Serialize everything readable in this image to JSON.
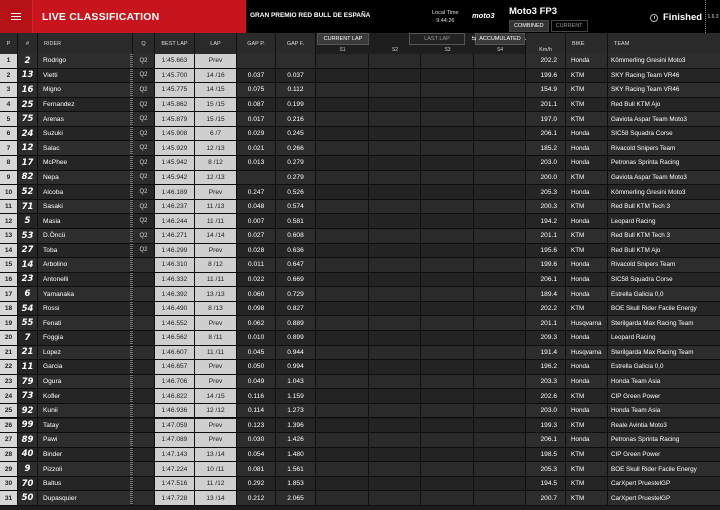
{
  "header": {
    "title": "LIVE CLASSIFICATION",
    "event": "GRAN PREMIO RED BULL DE ESPAÑA",
    "local_time_label": "Local Time",
    "local_time": "9:44:26",
    "logo": "moto3",
    "session": "Moto3 FP3",
    "tab_combined": "COMBINED",
    "tab_current": "CURRENT",
    "status": "Finished",
    "version": "1.6.3"
  },
  "columns": {
    "pos": "P",
    "num": "#",
    "rider": "RIDER",
    "q": "Q",
    "best_lap": "BEST LAP",
    "lap": "LAP",
    "gap_p": "GAP P.",
    "gap_f": "GAP F.",
    "current_lap": "CURRENT LAP",
    "last_lap": "LAST LAP",
    "accumulated": "ACCUMULATED",
    "s1": "S1",
    "s2": "S2",
    "s3": "S3",
    "s4": "S4",
    "speed": "Km/h",
    "bike": "BIKE",
    "team": "TEAM"
  },
  "rows": [
    {
      "pos": "1",
      "num": "2",
      "rider": "Rodrigo",
      "q": "Q2",
      "best": "1:45.663",
      "lap": "Prev",
      "gapp": "",
      "gapf": "",
      "speed": "202.2",
      "bike": "Honda",
      "team": "Kömmerling Gresini Moto3"
    },
    {
      "pos": "2",
      "num": "13",
      "rider": "Vietti",
      "q": "Q2",
      "best": "1:45.700",
      "lap": "14 /16",
      "gapp": "0.037",
      "gapf": "0.037",
      "speed": "199.6",
      "bike": "KTM",
      "team": "SKY Racing Team VR46"
    },
    {
      "pos": "3",
      "num": "16",
      "rider": "Migno",
      "q": "Q2",
      "best": "1:45.775",
      "lap": "14 /15",
      "gapp": "0.075",
      "gapf": "0.112",
      "speed": "154.9",
      "bike": "KTM",
      "team": "SKY Racing Team VR46"
    },
    {
      "pos": "4",
      "num": "25",
      "rider": "Fernandez",
      "q": "Q2",
      "best": "1:45.862",
      "lap": "15 /15",
      "gapp": "0.087",
      "gapf": "0.199",
      "speed": "201.1",
      "bike": "KTM",
      "team": "Red Bull KTM Ajo"
    },
    {
      "pos": "5",
      "num": "75",
      "rider": "Arenas",
      "q": "Q2",
      "best": "1:45.879",
      "lap": "15 /15",
      "gapp": "0.017",
      "gapf": "0.216",
      "speed": "197.0",
      "bike": "KTM",
      "team": "Gaviota Aspar Team Moto3"
    },
    {
      "pos": "6",
      "num": "24",
      "rider": "Suzuki",
      "q": "Q2",
      "best": "1:45.908",
      "lap": "6 /7",
      "gapp": "0.029",
      "gapf": "0.245",
      "speed": "206.1",
      "bike": "Honda",
      "team": "SIC58 Squadra Corse"
    },
    {
      "pos": "7",
      "num": "12",
      "rider": "Salac",
      "q": "Q2",
      "best": "1:45.929",
      "lap": "12 /13",
      "gapp": "0.021",
      "gapf": "0.266",
      "speed": "185.2",
      "bike": "Honda",
      "team": "Rivacold Snipers Team"
    },
    {
      "pos": "8",
      "num": "17",
      "rider": "McPhee",
      "q": "Q2",
      "best": "1:45.942",
      "lap": "8 /12",
      "gapp": "0.013",
      "gapf": "0.279",
      "speed": "203.0",
      "bike": "Honda",
      "team": "Petronas Sprinta Racing"
    },
    {
      "pos": "9",
      "num": "82",
      "rider": "Nepa",
      "q": "Q2",
      "best": "1:45.942",
      "lap": "12 /13",
      "gapp": "",
      "gapf": "0.279",
      "speed": "200.0",
      "bike": "KTM",
      "team": "Gaviota Aspar Team Moto3"
    },
    {
      "pos": "10",
      "num": "52",
      "rider": "Alcoba",
      "q": "Q2",
      "best": "1:46.189",
      "lap": "Prev",
      "gapp": "0.247",
      "gapf": "0.526",
      "speed": "205.3",
      "bike": "Honda",
      "team": "Kömmerling Gresini Moto3"
    },
    {
      "pos": "11",
      "num": "71",
      "rider": "Sasaki",
      "q": "Q2",
      "best": "1:46.237",
      "lap": "11 /13",
      "gapp": "0.048",
      "gapf": "0.574",
      "speed": "200.3",
      "bike": "KTM",
      "team": "Red Bull KTM Tech 3"
    },
    {
      "pos": "12",
      "num": "5",
      "rider": "Masia",
      "q": "Q2",
      "best": "1:46.244",
      "lap": "11 /11",
      "gapp": "0.007",
      "gapf": "0.581",
      "speed": "194.2",
      "bike": "Honda",
      "team": "Leopard Racing"
    },
    {
      "pos": "13",
      "num": "53",
      "rider": "D.Öncü",
      "q": "Q2",
      "best": "1:46.271",
      "lap": "14 /14",
      "gapp": "0.027",
      "gapf": "0.608",
      "speed": "201.1",
      "bike": "KTM",
      "team": "Red Bull KTM Tech 3"
    },
    {
      "pos": "14",
      "num": "27",
      "rider": "Toba",
      "q": "Q2",
      "best": "1:46.299",
      "lap": "Prev",
      "gapp": "0.028",
      "gapf": "0.636",
      "speed": "195.6",
      "bike": "KTM",
      "team": "Red Bull KTM Ajo"
    },
    {
      "pos": "15",
      "num": "14",
      "rider": "Arbolino",
      "q": "",
      "best": "1:46.310",
      "lap": "8 /12",
      "gapp": "0.011",
      "gapf": "0.647",
      "speed": "199.6",
      "bike": "Honda",
      "team": "Rivacold Snipers Team"
    },
    {
      "pos": "16",
      "num": "23",
      "rider": "Antonelli",
      "q": "",
      "best": "1:46.332",
      "lap": "11 /11",
      "gapp": "0.022",
      "gapf": "0.669",
      "speed": "206.1",
      "bike": "Honda",
      "team": "SIC58 Squadra Corse"
    },
    {
      "pos": "17",
      "num": "6",
      "rider": "Yamanaka",
      "q": "",
      "best": "1:46.392",
      "lap": "13 /13",
      "gapp": "0.060",
      "gapf": "0.729",
      "speed": "189.4",
      "bike": "Honda",
      "team": "Estrella Galicia 0,0"
    },
    {
      "pos": "18",
      "num": "54",
      "rider": "Rossi",
      "q": "",
      "best": "1:46.490",
      "lap": "8 /13",
      "gapp": "0.098",
      "gapf": "0.827",
      "speed": "202.2",
      "bike": "KTM",
      "team": "BOE Skull Rider Facile Energy"
    },
    {
      "pos": "19",
      "num": "55",
      "rider": "Fenati",
      "q": "",
      "best": "1:46.552",
      "lap": "Prev",
      "gapp": "0.062",
      "gapf": "0.889",
      "speed": "201.1",
      "bike": "Husqvarna",
      "team": "Sterilgarda Max Racing Team"
    },
    {
      "pos": "20",
      "num": "7",
      "rider": "Foggia",
      "q": "",
      "best": "1:46.562",
      "lap": "8 /11",
      "gapp": "0.010",
      "gapf": "0.899",
      "speed": "209.3",
      "bike": "Honda",
      "team": "Leopard Racing"
    },
    {
      "pos": "21",
      "num": "21",
      "rider": "Lopez",
      "q": "",
      "best": "1:46.607",
      "lap": "11 /11",
      "gapp": "0.045",
      "gapf": "0.944",
      "speed": "191.4",
      "bike": "Husqvarna",
      "team": "Sterilgarda Max Racing Team"
    },
    {
      "pos": "22",
      "num": "11",
      "rider": "Garcia",
      "q": "",
      "best": "1:46.657",
      "lap": "Prev",
      "gapp": "0.050",
      "gapf": "0.994",
      "speed": "196.2",
      "bike": "Honda",
      "team": "Estrella Galicia 0,0"
    },
    {
      "pos": "23",
      "num": "79",
      "rider": "Ogura",
      "q": "",
      "best": "1:46.706",
      "lap": "Prev",
      "gapp": "0.049",
      "gapf": "1.043",
      "speed": "203.3",
      "bike": "Honda",
      "team": "Honda Team Asia"
    },
    {
      "pos": "24",
      "num": "73",
      "rider": "Kofler",
      "q": "",
      "best": "1:46.822",
      "lap": "14 /15",
      "gapp": "0.116",
      "gapf": "1.159",
      "speed": "202.6",
      "bike": "KTM",
      "team": "CIP Green Power"
    },
    {
      "pos": "25",
      "num": "92",
      "rider": "Kunii",
      "q": "",
      "best": "1:46.936",
      "lap": "12 /12",
      "gapp": "0.114",
      "gapf": "1.273",
      "speed": "203.0",
      "bike": "Honda",
      "team": "Honda Team Asia"
    },
    {
      "pos": "26",
      "num": "99",
      "rider": "Tatay",
      "q": "",
      "best": "1:47.059",
      "lap": "Prev",
      "gapp": "0.123",
      "gapf": "1.396",
      "speed": "199.3",
      "bike": "KTM",
      "team": "Reale Avintia Moto3"
    },
    {
      "pos": "27",
      "num": "89",
      "rider": "Pawi",
      "q": "",
      "best": "1:47.089",
      "lap": "Prev",
      "gapp": "0.030",
      "gapf": "1.426",
      "speed": "206.1",
      "bike": "Honda",
      "team": "Petronas Sprinta Racing"
    },
    {
      "pos": "28",
      "num": "40",
      "rider": "Binder",
      "q": "",
      "best": "1:47.143",
      "lap": "13 /14",
      "gapp": "0.054",
      "gapf": "1.480",
      "speed": "198.5",
      "bike": "KTM",
      "team": "CIP Green Power"
    },
    {
      "pos": "29",
      "num": "9",
      "rider": "Pizzoli",
      "q": "",
      "best": "1:47.224",
      "lap": "10 /11",
      "gapp": "0.081",
      "gapf": "1.561",
      "speed": "205.3",
      "bike": "KTM",
      "team": "BOE Skull Rider Facile Energy"
    },
    {
      "pos": "30",
      "num": "70",
      "rider": "Baltus",
      "q": "",
      "best": "1:47.516",
      "lap": "11 /12",
      "gapp": "0.292",
      "gapf": "1.853",
      "speed": "194.5",
      "bike": "KTM",
      "team": "CarXpert PruestelGP"
    },
    {
      "pos": "31",
      "num": "50",
      "rider": "Dupasquier",
      "q": "",
      "best": "1:47.728",
      "lap": "13 /14",
      "gapp": "0.212",
      "gapf": "2.065",
      "speed": "200.7",
      "bike": "KTM",
      "team": "CarXpert PruestelGP"
    }
  ]
}
